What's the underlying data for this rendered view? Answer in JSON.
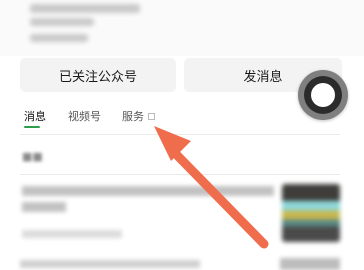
{
  "actions": {
    "follow_label": "已关注公众号",
    "message_label": "发消息"
  },
  "tabs": [
    {
      "label": "消息",
      "active": true
    },
    {
      "label": "视频号",
      "active": false
    },
    {
      "label": "服务",
      "active": false
    }
  ],
  "colors": {
    "accent": "#2aa04a",
    "annotation_arrow": "#ef6c4c",
    "button_bg": "#f3f3f3"
  },
  "icons": {
    "tab_dropdown": "dropdown-icon",
    "floating_button": "assistive-touch-icon",
    "annotation": "arrow-pointer-icon"
  }
}
